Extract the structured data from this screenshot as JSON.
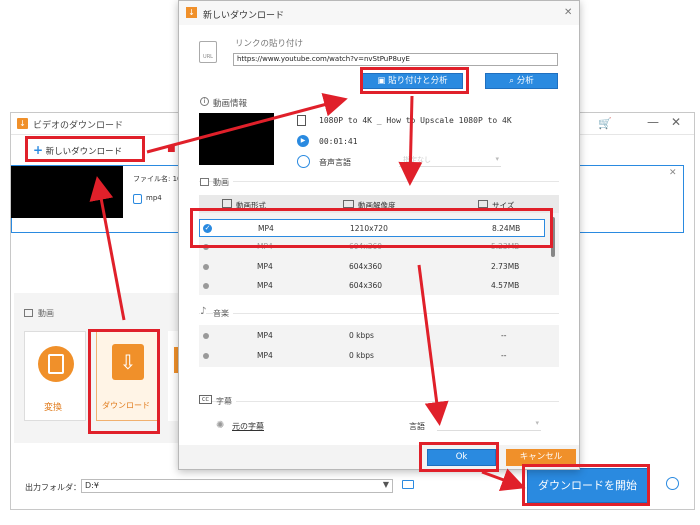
{
  "main": {
    "title": "ビデオのダウンロード",
    "new_download": "新しいダウンロード",
    "file_name_label": "ファイル名: 108",
    "file_format": "mp4",
    "section_video": "動画",
    "convert_label": "変換",
    "download_label": "ダウンロード",
    "output_label": "出力フォルダ：",
    "output_path": "D:¥",
    "start_button": "ダウンロードを開始"
  },
  "dialog": {
    "title": "新しいダウンロード",
    "paste_section": "リンクの貼り付け",
    "url_value": "https://www.youtube.com/watch?v=nvStPuP8uyE",
    "paste_analyze": "貼り付けと分析",
    "analyze": "分析",
    "video_info": "動画情報",
    "video_title": "1080P to 4K _ How to Upscale 1080P to 4K",
    "duration": "00:01:41",
    "audio_lang_label": "音声言語",
    "audio_lang_value": "指定なし",
    "video_section": "動画",
    "col_format": "動画形式",
    "col_resolution": "動画解像度",
    "col_size": "サイズ",
    "video_rows": [
      {
        "format": "MP4",
        "resolution": "1210x720",
        "size": "8.24MB"
      },
      {
        "format": "MP4",
        "resolution": "604x360",
        "size": "5.23MB"
      },
      {
        "format": "MP4",
        "resolution": "604x360",
        "size": "2.73MB"
      },
      {
        "format": "MP4",
        "resolution": "604x360",
        "size": "4.57MB"
      }
    ],
    "audio_section": "音楽",
    "audio_rows": [
      {
        "format": "MP4",
        "bitrate": "0 kbps",
        "size": "--"
      },
      {
        "format": "MP4",
        "bitrate": "0 kbps",
        "size": "--"
      }
    ],
    "subtitle_section": "字幕",
    "original_sub": "元の字幕",
    "language_label": "言語",
    "ok": "Ok",
    "cancel": "キャンセル"
  },
  "colors": {
    "accent_blue": "#2a8ae0",
    "red_highlight": "#e0202a",
    "orange": "#f0902a"
  }
}
